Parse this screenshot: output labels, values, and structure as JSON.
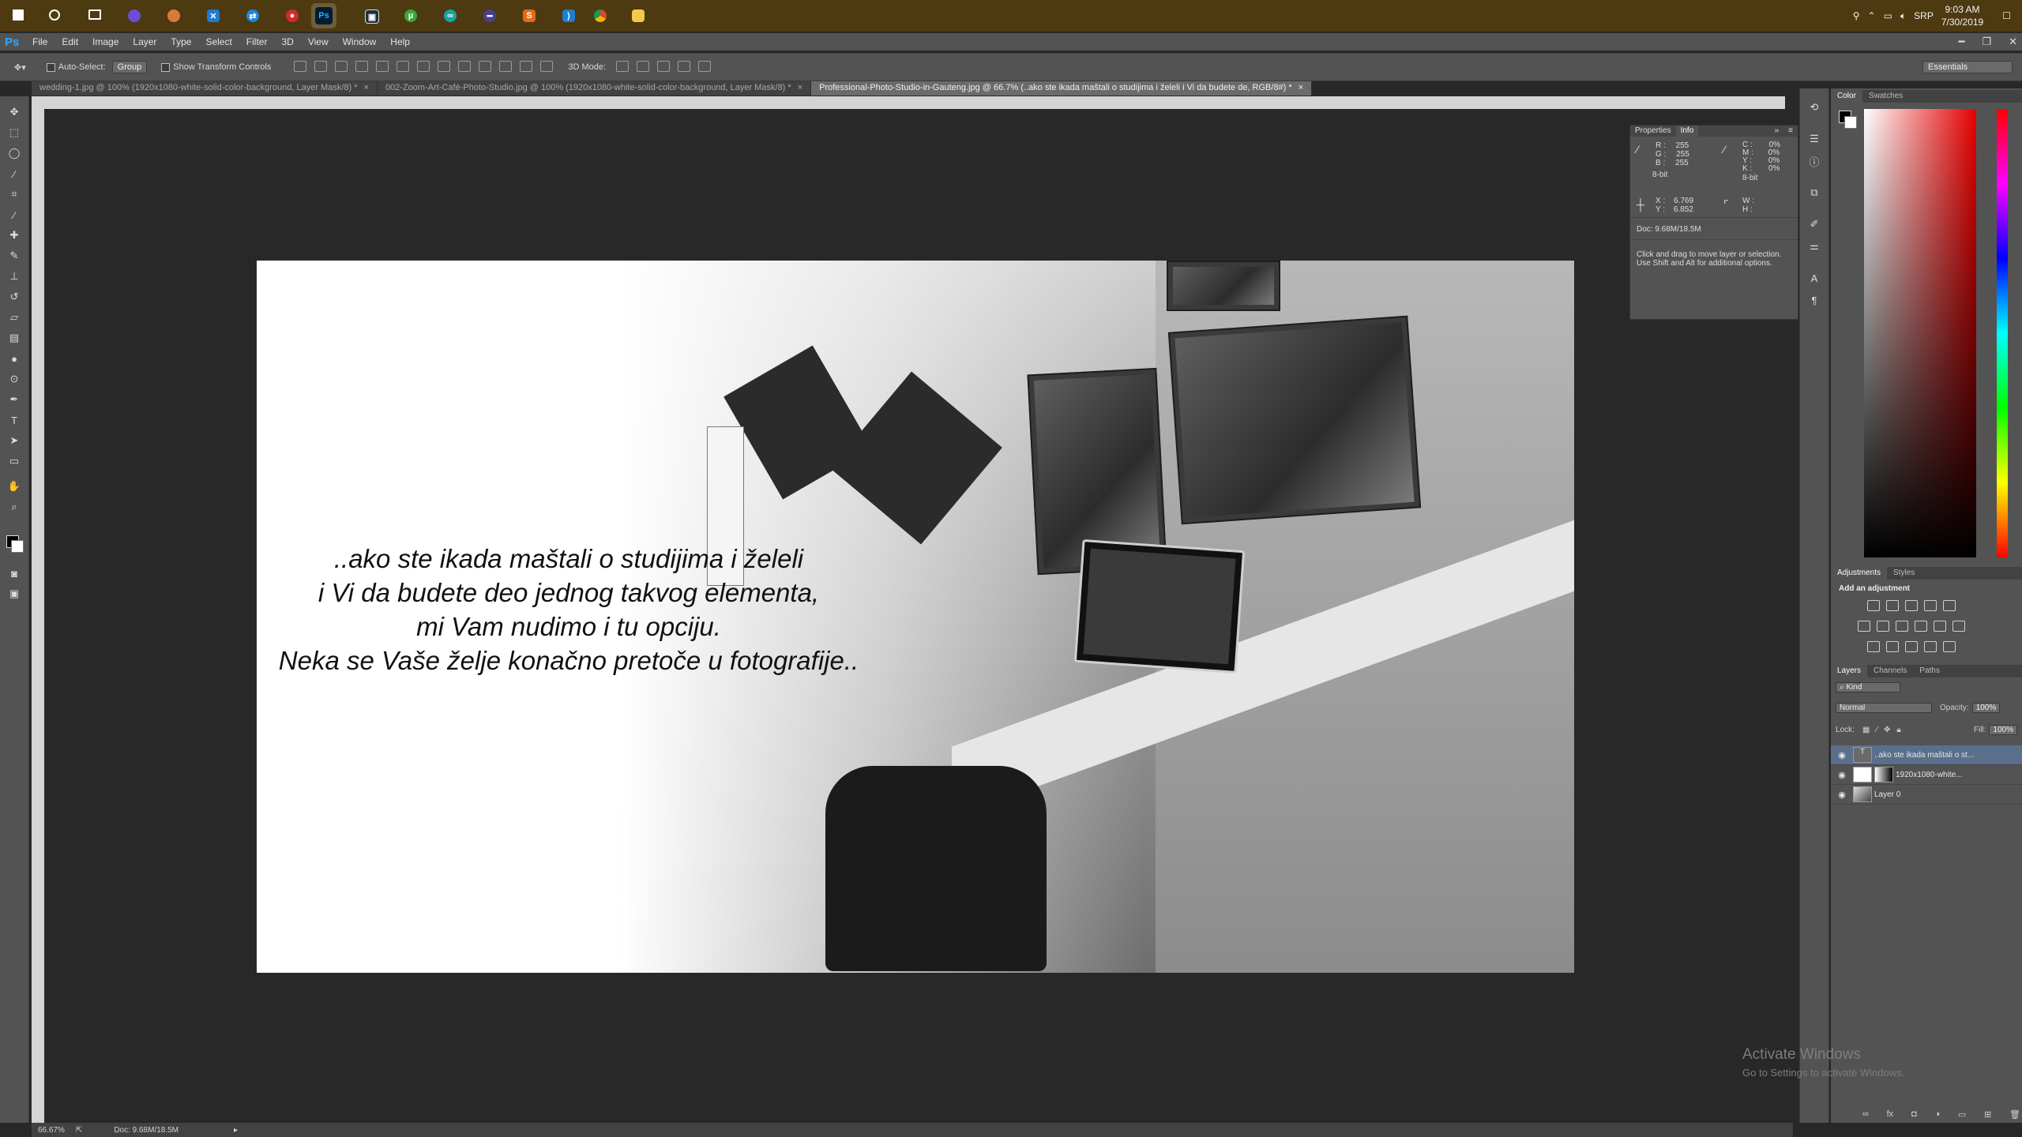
{
  "taskbar": {
    "pinned": [
      "windows-start",
      "search",
      "task-view",
      "app-1",
      "app-2",
      "app-3",
      "app-4",
      "app-5",
      "photoshop",
      "app-7",
      "app-8",
      "app-9",
      "app-10",
      "app-11",
      "vscode",
      "chrome",
      "file-explorer"
    ],
    "photoshop_label": "Ps",
    "tray": {
      "lang": "SRP",
      "time": "9:03 AM",
      "date": "7/30/2019"
    }
  },
  "menubar": {
    "logo": "Ps",
    "items": [
      "File",
      "Edit",
      "Image",
      "Layer",
      "Type",
      "Select",
      "Filter",
      "3D",
      "View",
      "Window",
      "Help"
    ]
  },
  "options": {
    "auto_select": "Auto-Select:",
    "auto_select_value": "Group",
    "show_transform": "Show Transform Controls",
    "mode_3d": "3D Mode:",
    "workspace": "Essentials"
  },
  "tabs": [
    {
      "label": "wedding-1.jpg @ 100% (1920x1080-white-solid-color-background, Layer Mask/8) *",
      "active": false
    },
    {
      "label": "002-Zoom-Art-Café-Photo-Studio.jpg @ 100% (1920x1080-white-solid-color-background, Layer Mask/8) *",
      "active": false
    },
    {
      "label": "Professional-Photo-Studio-in-Gauteng.jpg @ 66.7% (..ako ste ikada maštali o studijima i želeli  i Vi da budete de, RGB/8#) *",
      "active": true
    }
  ],
  "canvas": {
    "lines": [
      "..ako ste ikada maštali o studijima i želeli",
      "i Vi da budete deo jednog takvog elementa,",
      "mi Vam nudimo i tu opciju.",
      "Neka se Vaše želje konačno pretoče u fotografije.."
    ]
  },
  "info_panel": {
    "tabs": [
      "Properties",
      "Info"
    ],
    "rgb": {
      "R": "255",
      "G": "255",
      "B": "255"
    },
    "cmyk": {
      "C": "0%",
      "M": "0%",
      "Y": "0%",
      "K": "0%"
    },
    "bit_left": "8-bit",
    "bit_right": "8-bit",
    "xy": {
      "X": "6.769",
      "Y": "6.852"
    },
    "wh": {
      "W": "",
      "H": ""
    },
    "doc": "Doc: 9.68M/18.5M",
    "hint_1": "Click and drag to move layer or selection.",
    "hint_2": "Use Shift and Alt for additional options."
  },
  "color_panel": {
    "tabs": [
      "Color",
      "Swatches"
    ]
  },
  "adjustments": {
    "tabs": [
      "Adjustments",
      "Styles"
    ],
    "title": "Add an adjustment"
  },
  "layers_panel": {
    "tabs": [
      "Layers",
      "Channels",
      "Paths"
    ],
    "kind": "Kind",
    "blend": "Normal",
    "opacity_label": "Opacity:",
    "opacity": "100%",
    "lock_label": "Lock:",
    "fill_label": "Fill:",
    "fill": "100%",
    "layers": [
      {
        "name": "..ako ste ikada maštali o st...",
        "type": "text",
        "selected": true
      },
      {
        "name": "1920x1080-white...",
        "type": "mask",
        "selected": false
      },
      {
        "name": "Layer 0",
        "type": "image",
        "selected": false
      }
    ]
  },
  "statusbar": {
    "zoom": "66.67%",
    "doc": "Doc: 9.68M/18.5M"
  },
  "watermark": {
    "title": "Activate Windows",
    "subtitle": "Go to Settings to activate Windows."
  }
}
